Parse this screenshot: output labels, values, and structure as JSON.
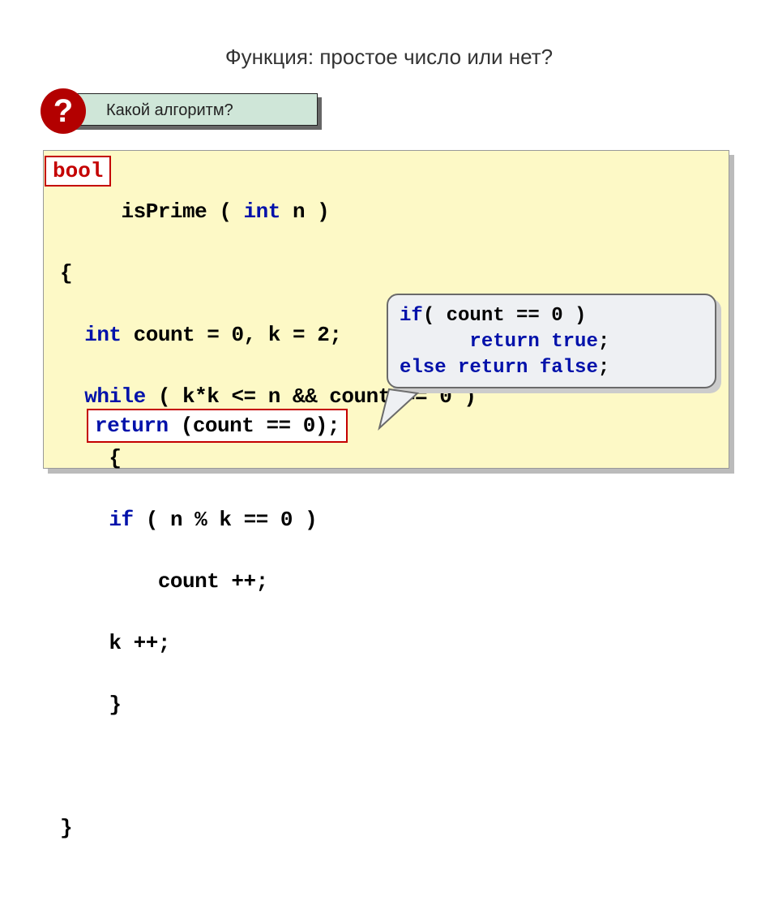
{
  "title": "Функция: простое число или нет?",
  "question": {
    "mark": "?",
    "text": "Какой алгоритм?"
  },
  "code": {
    "bool": "bool",
    "l1_a": "     isPrime ( ",
    "l1_int": "int",
    "l1_b": " n )",
    "l2": "{",
    "l3_a": "  ",
    "l3_int": "int",
    "l3_b": " count = ",
    "l3_n1": "0",
    "l3_c": ", k = ",
    "l3_n2": "2",
    "l3_d": ";",
    "l4_a": "  ",
    "l4_while": "while",
    "l4_b": " ( k*k <= n && count == ",
    "l4_n": "0",
    "l4_c": " )",
    "l5": "    {",
    "l6_a": "    ",
    "l6_if": "if",
    "l6_b": " ( n % k == ",
    "l6_n": "0",
    "l6_c": " )",
    "l7": "        count ++;",
    "l8": "    k ++;",
    "l9": "    }",
    "l11": "}"
  },
  "return_line": {
    "kw": "return",
    "rest": " (count == 0);"
  },
  "tooltip": {
    "l1_if": "if",
    "l1_rest": "( count == ",
    "l1_n": "0",
    "l1_end": " )",
    "l2_pad": "      ",
    "l2_ret": "return",
    "l2_val": " true",
    "l2_end": ";",
    "l3_else": "else",
    "l3_sp": " ",
    "l3_ret": "return",
    "l3_val": " false",
    "l3_end": ";"
  }
}
